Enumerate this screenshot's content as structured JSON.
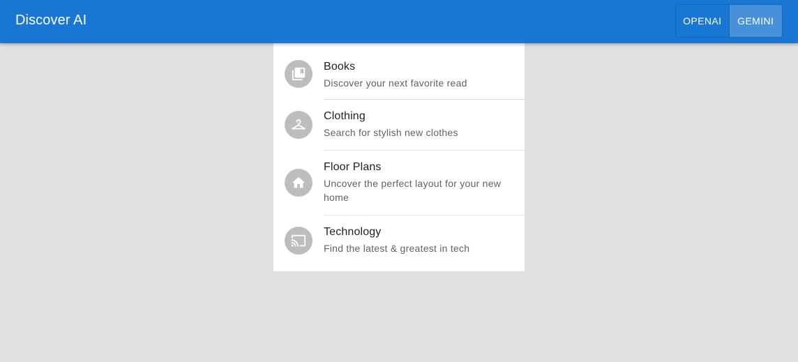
{
  "app": {
    "title": "Discover AI"
  },
  "provider_toggle": {
    "options": [
      {
        "label": "OPENAI",
        "selected": false
      },
      {
        "label": "GEMINI",
        "selected": true
      }
    ]
  },
  "categories": [
    {
      "icon": "book-icon",
      "title": "Books",
      "subtitle": "Discover your next favorite read"
    },
    {
      "icon": "hanger-icon",
      "title": "Clothing",
      "subtitle": "Search for stylish new clothes"
    },
    {
      "icon": "house-icon",
      "title": "Floor Plans",
      "subtitle": "Uncover the perfect layout for your new home"
    },
    {
      "icon": "cast-icon",
      "title": "Technology",
      "subtitle": "Find the latest & greatest in tech"
    }
  ],
  "colors": {
    "app_bar": "#1976d2",
    "background": "#e0e0e0",
    "avatar": "#bdbdbd"
  }
}
